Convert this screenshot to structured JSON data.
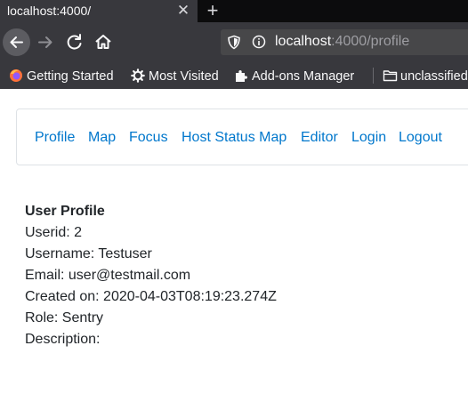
{
  "browser": {
    "tab_title": "localhost:4000/",
    "url_host": "localhost",
    "url_rest": ":4000/profile",
    "bookmarks": [
      {
        "label": "Getting Started",
        "icon": "firefox-icon"
      },
      {
        "label": "Most Visited",
        "icon": "gear-icon"
      },
      {
        "label": "Add-ons Manager",
        "icon": "puzzle-icon"
      },
      {
        "label": "unclassified",
        "icon": "folder-icon"
      }
    ]
  },
  "nav": {
    "links": [
      "Profile",
      "Map",
      "Focus",
      "Host Status Map",
      "Editor",
      "Login",
      "Logout"
    ]
  },
  "profile": {
    "heading": "User Profile",
    "userid": "Userid: 2",
    "username": "Username: Testuser",
    "email": "Email: user@testmail.com",
    "created": "Created on: 2020-04-03T08:19:23.274Z",
    "role": "Role: Sentry",
    "description": "Description:"
  },
  "colors": {
    "link": "#0077cc",
    "chrome_dark": "#38383d",
    "tabbar": "#0c0c0d"
  }
}
